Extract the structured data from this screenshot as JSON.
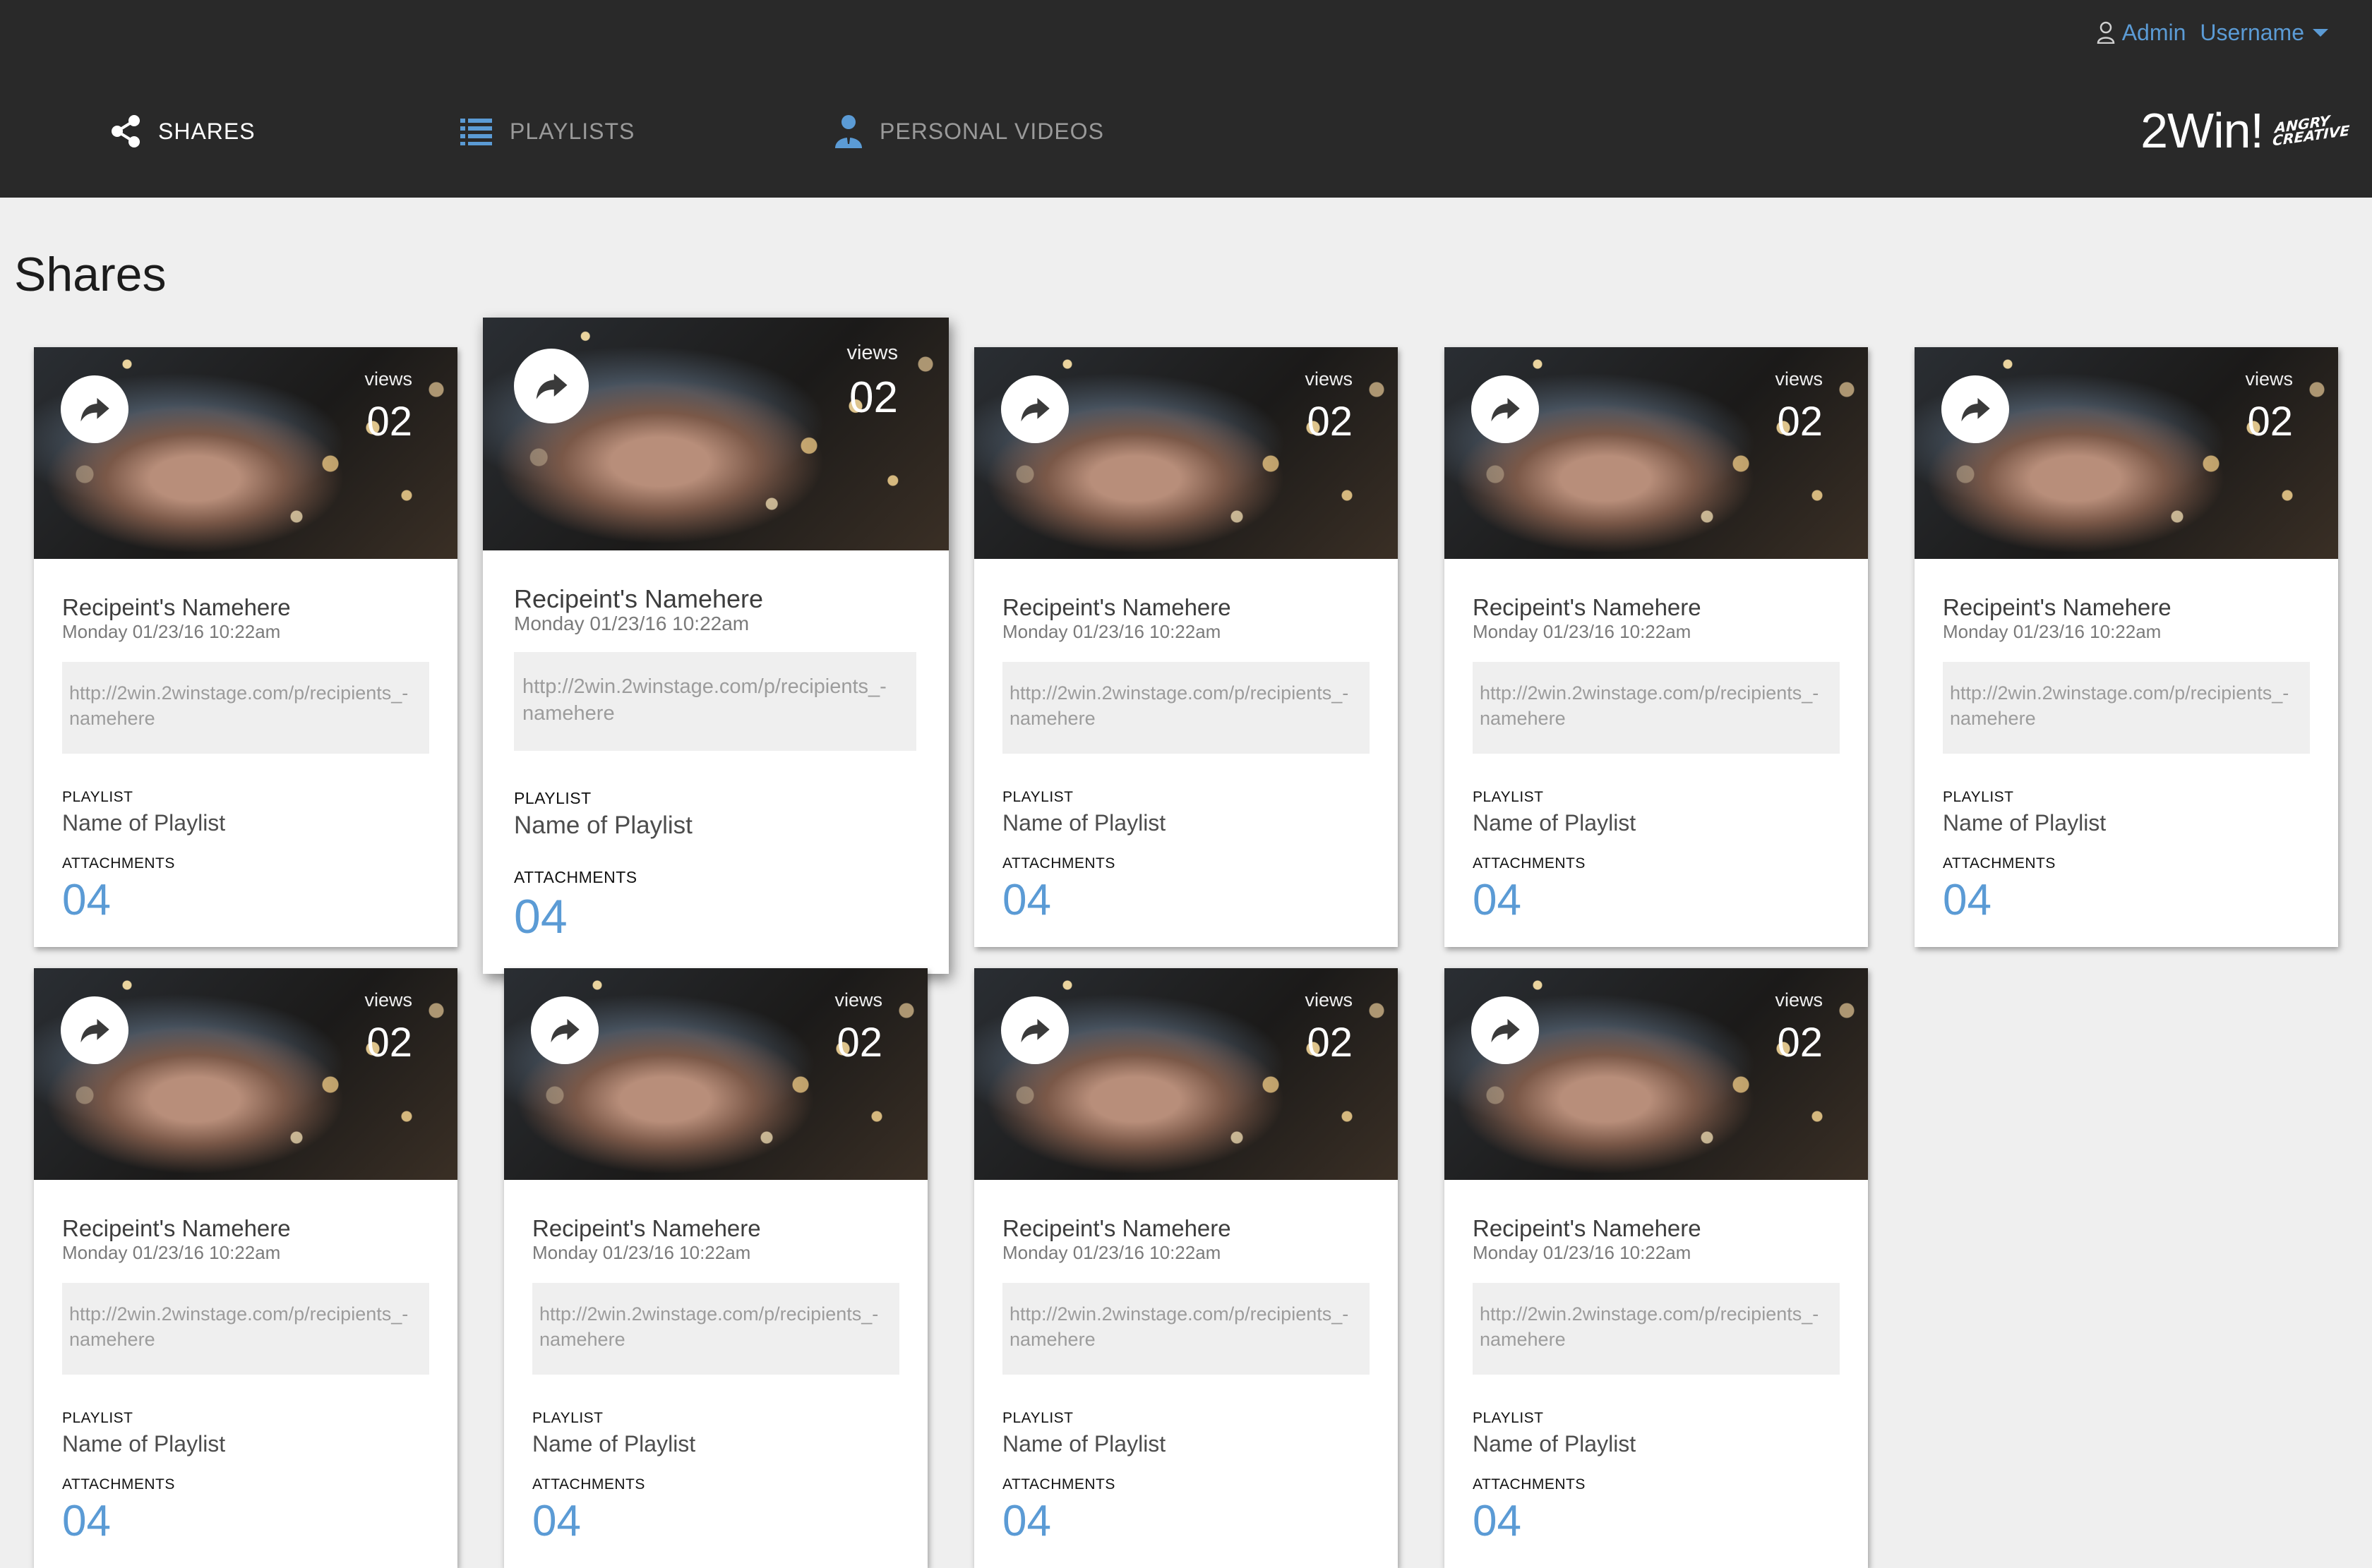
{
  "header": {
    "user": {
      "role": "Admin",
      "username": "Username"
    },
    "nav": [
      {
        "label": "SHARES",
        "active": true,
        "icon": "share-icon"
      },
      {
        "label": "PLAYLISTS",
        "active": false,
        "icon": "list-icon"
      },
      {
        "label": "PERSONAL VIDEOS",
        "active": false,
        "icon": "person-icon"
      }
    ],
    "brand": {
      "name": "2Win!",
      "mark_line1": "ANGRY",
      "mark_line2": "CREATIVE"
    }
  },
  "page_title": "Shares",
  "colors": {
    "header_bg": "#292929",
    "accent": "#5b9bd5",
    "page_bg": "#efefef"
  },
  "cards": [
    {
      "views_label": "views",
      "views": "02",
      "recipient": "Recipeint's Namehere",
      "date": "Monday 01/23/16 10:22am",
      "link_line1": "http://2win.2winstage.com/p/recipients_-",
      "link_line2": "namehere",
      "playlist_label": "PLAYLIST",
      "playlist": "Name of Playlist",
      "attachments_label": "ATTACHMENTS",
      "attachments": "04"
    },
    {
      "views_label": "views",
      "views": "02",
      "recipient": "Recipeint's Namehere",
      "date": "Monday 01/23/16 10:22am",
      "link_line1": "http://2win.2winstage.com/p/recipients_-",
      "link_line2": "namehere",
      "playlist_label": "PLAYLIST",
      "playlist": "Name of Playlist",
      "attachments_label": "ATTACHMENTS",
      "attachments": "04"
    },
    {
      "views_label": "views",
      "views": "02",
      "recipient": "Recipeint's Namehere",
      "date": "Monday 01/23/16 10:22am",
      "link_line1": "http://2win.2winstage.com/p/recipients_-",
      "link_line2": "namehere",
      "playlist_label": "PLAYLIST",
      "playlist": "Name of Playlist",
      "attachments_label": "ATTACHMENTS",
      "attachments": "04"
    },
    {
      "views_label": "views",
      "views": "02",
      "recipient": "Recipeint's Namehere",
      "date": "Monday 01/23/16 10:22am",
      "link_line1": "http://2win.2winstage.com/p/recipients_-",
      "link_line2": "namehere",
      "playlist_label": "PLAYLIST",
      "playlist": "Name of Playlist",
      "attachments_label": "ATTACHMENTS",
      "attachments": "04"
    },
    {
      "views_label": "views",
      "views": "02",
      "recipient": "Recipeint's Namehere",
      "date": "Monday 01/23/16 10:22am",
      "link_line1": "http://2win.2winstage.com/p/recipients_-",
      "link_line2": "namehere",
      "playlist_label": "PLAYLIST",
      "playlist": "Name of Playlist",
      "attachments_label": "ATTACHMENTS",
      "attachments": "04"
    },
    {
      "views_label": "views",
      "views": "02",
      "recipient": "Recipeint's Namehere",
      "date": "Monday 01/23/16 10:22am",
      "link_line1": "http://2win.2winstage.com/p/recipients_-",
      "link_line2": "namehere",
      "playlist_label": "PLAYLIST",
      "playlist": "Name of Playlist",
      "attachments_label": "ATTACHMENTS",
      "attachments": "04"
    },
    {
      "views_label": "views",
      "views": "02",
      "recipient": "Recipeint's Namehere",
      "date": "Monday 01/23/16 10:22am",
      "link_line1": "http://2win.2winstage.com/p/recipients_-",
      "link_line2": "namehere",
      "playlist_label": "PLAYLIST",
      "playlist": "Name of Playlist",
      "attachments_label": "ATTACHMENTS",
      "attachments": "04"
    },
    {
      "views_label": "views",
      "views": "02",
      "recipient": "Recipeint's Namehere",
      "date": "Monday 01/23/16 10:22am",
      "link_line1": "http://2win.2winstage.com/p/recipients_-",
      "link_line2": "namehere",
      "playlist_label": "PLAYLIST",
      "playlist": "Name of Playlist",
      "attachments_label": "ATTACHMENTS",
      "attachments": "04"
    },
    {
      "views_label": "views",
      "views": "02",
      "recipient": "Recipeint's Namehere",
      "date": "Monday 01/23/16 10:22am",
      "link_line1": "http://2win.2winstage.com/p/recipients_-",
      "link_line2": "namehere",
      "playlist_label": "PLAYLIST",
      "playlist": "Name of Playlist",
      "attachments_label": "ATTACHMENTS",
      "attachments": "04"
    }
  ]
}
